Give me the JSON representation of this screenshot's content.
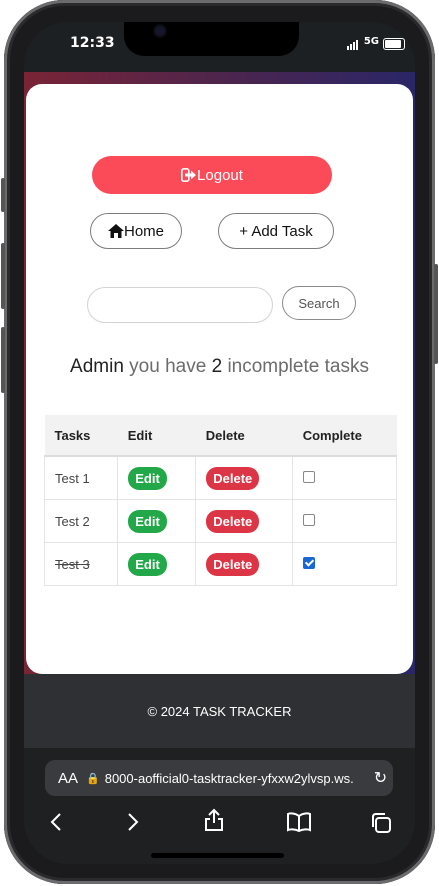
{
  "status_bar": {
    "time": "12:33",
    "network": "5G"
  },
  "nav": {
    "logout_label": "Logout",
    "home_label": "Home",
    "add_task_label": "+ Add Task"
  },
  "search": {
    "value": "",
    "placeholder": "",
    "button_label": "Search"
  },
  "summary": {
    "user": "Admin",
    "text_before": "you have",
    "count": "2",
    "text_after": "incomplete tasks"
  },
  "table": {
    "headers": [
      "Tasks",
      "Edit",
      "Delete",
      "Complete"
    ],
    "rows": [
      {
        "task": "Test 1",
        "edit": "Edit",
        "delete": "Delete",
        "complete": false
      },
      {
        "task": "Test 2",
        "edit": "Edit",
        "delete": "Delete",
        "complete": false
      },
      {
        "task": "Test 3",
        "edit": "Edit",
        "delete": "Delete",
        "complete": true
      }
    ]
  },
  "footer": {
    "text": "© 2024 TASK TRACKER"
  },
  "browser": {
    "aa_label": "AA",
    "url": "8000-aofficial0-tasktracker-yfxxw2ylvsp.ws."
  },
  "colors": {
    "logout": "#fb4b59",
    "edit": "#23a849",
    "delete": "#dc3545",
    "checkbox": "#1967d2"
  }
}
